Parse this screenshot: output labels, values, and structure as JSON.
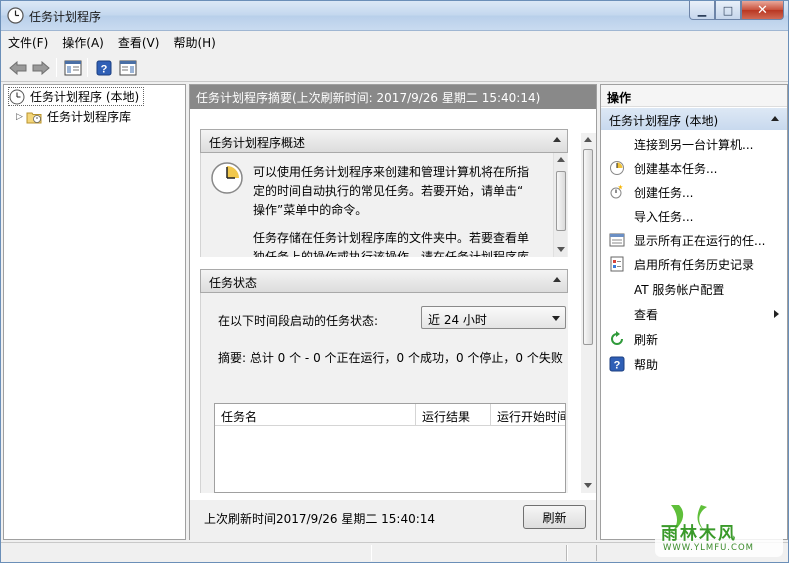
{
  "window": {
    "title": "任务计划程序"
  },
  "menu": [
    "文件(F)",
    "操作(A)",
    "查看(V)",
    "帮助(H)"
  ],
  "tree": {
    "root_label": "任务计划程序 (本地)",
    "child_label": "任务计划程序库"
  },
  "summary": {
    "header": "任务计划程序摘要(上次刷新时间: 2017/9/26 星期二 15:40:14)",
    "overview_title": "任务计划程序概述",
    "overview_p1_lines": [
      "可以使用任务计划程序来创建和管理计算机将在所指",
      "定的时间自动执行的常见任务。若要开始，请单击“",
      "操作”菜单中的命令。"
    ],
    "overview_p2_lines": [
      "任务存储在任务计划程序库的文件夹中。若要查看单",
      "独任务上的操作或执行该操作，请在任务计划程序库"
    ],
    "status_title": "任务状态",
    "status_label": "在以下时间段启动的任务状态:",
    "status_period": "近 24 小时",
    "status_summary": "摘要: 总计 0 个 - 0 个正在运行，0 个成功，0 个停止，0 个失败",
    "columns": [
      "任务名",
      "运行结果",
      "运行开始时间"
    ],
    "last_refresh": "上次刷新时间2017/9/26 星期二 15:40:14",
    "refresh_button": "刷新"
  },
  "actions": {
    "title": "操作",
    "group": "任务计划程序 (本地)",
    "items": [
      {
        "label": "连接到另一台计算机...",
        "icon": "none"
      },
      {
        "label": "创建基本任务...",
        "icon": "basic-task-icon"
      },
      {
        "label": "创建任务...",
        "icon": "create-task-icon"
      },
      {
        "label": "导入任务...",
        "icon": "none"
      },
      {
        "label": "显示所有正在运行的任...",
        "icon": "running-tasks-icon"
      },
      {
        "label": "启用所有任务历史记录",
        "icon": "history-icon"
      },
      {
        "label": "AT 服务帐户配置",
        "icon": "none"
      },
      {
        "label": "查看",
        "icon": "none"
      },
      {
        "label": "刷新",
        "icon": "refresh-icon"
      },
      {
        "label": "帮助",
        "icon": "help-icon"
      }
    ]
  },
  "watermark": {
    "brand": "雨林木风",
    "url": "WWW.YLMFU.COM"
  },
  "colors": {
    "summary_header_bg": "#898989",
    "action_group_bg": "#c8d9ee",
    "titlebar": "#c3d7ee",
    "close_button": "#c8503b"
  }
}
